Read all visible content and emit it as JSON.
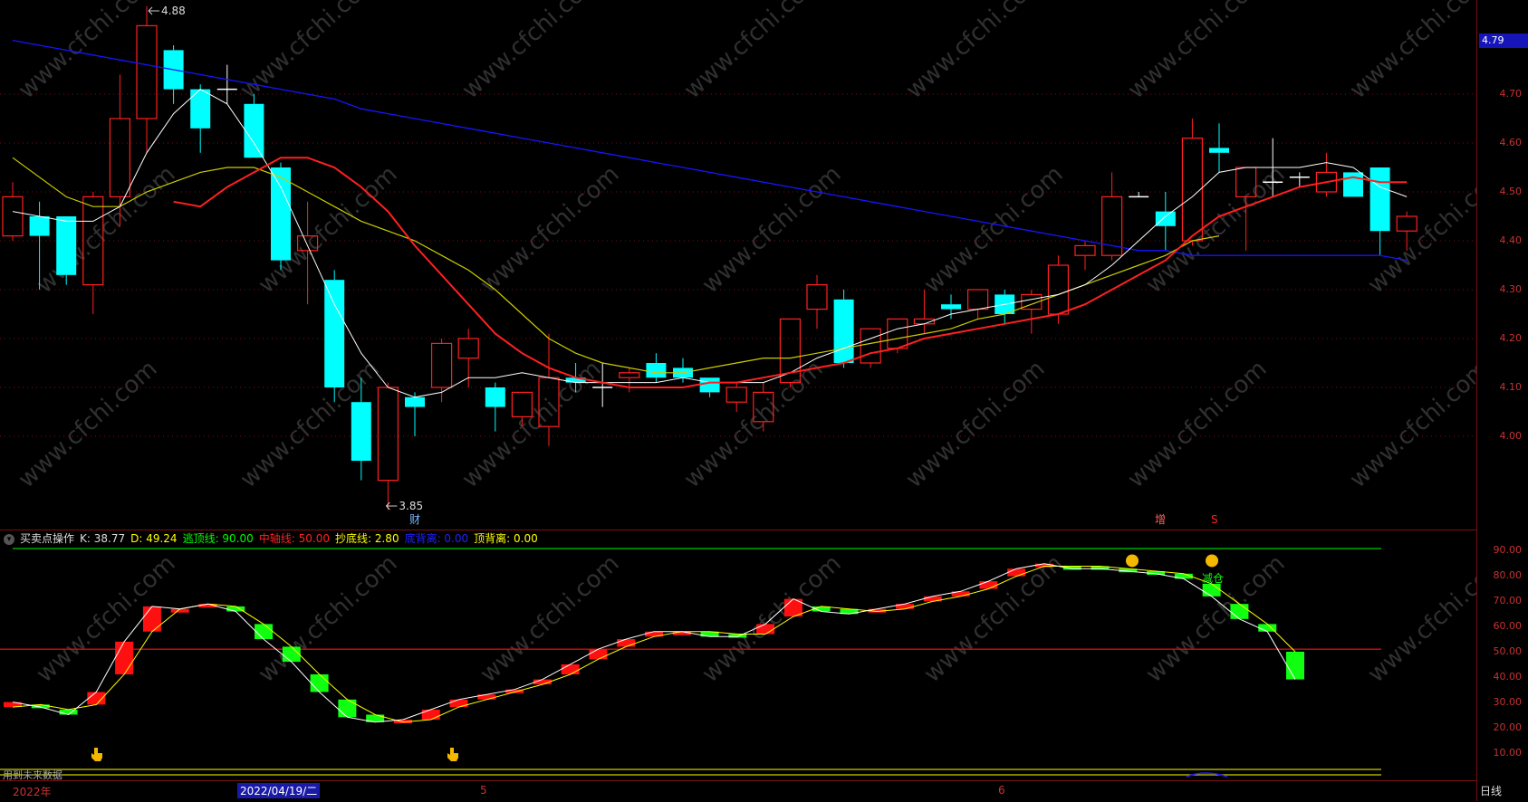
{
  "price_axis": {
    "ticks": [
      "4.70",
      "4.60",
      "4.50",
      "4.40",
      "4.30",
      "4.20",
      "4.10",
      "4.00"
    ],
    "current_price": "4.79"
  },
  "main_chart": {
    "high_label": "4.88",
    "low_label": "3.85",
    "tag_cai": "财",
    "tag_zeng": "增",
    "tag_s": "S",
    "colors": {
      "up": "#ff2020",
      "down": "#00ffff",
      "ma5": "#ffffff",
      "ma10": "#ff2020",
      "ma20": "#cccc00",
      "ma120": "#1515ff"
    }
  },
  "indicator": {
    "name": "买卖点操作",
    "k": "K: 38.77",
    "d": "D: 49.24",
    "top_line": "逃顶线: 90.00",
    "mid_line": "中轴线: 50.00",
    "bottom_line": "抄底线: 2.80",
    "bottom_div": "底背离: 0.00",
    "top_div": "顶背离: 0.00",
    "axis_ticks": [
      "90.00",
      "80.00",
      "70.00",
      "60.00",
      "50.00",
      "40.00",
      "30.00",
      "20.00",
      "10.00"
    ],
    "reduce_label": "减仓",
    "no_data_text": "用到未来数据"
  },
  "date_bar": {
    "year": "2022年",
    "selected_date": "2022/04/19/二",
    "month5": "5",
    "month6": "6",
    "period": "日线"
  },
  "watermark": "www.cfchi.com",
  "chart_data": {
    "type": "candlestick",
    "ohlc": [
      [
        4.41,
        4.52,
        4.4,
        4.49
      ],
      [
        4.45,
        4.48,
        4.3,
        4.41
      ],
      [
        4.45,
        4.45,
        4.31,
        4.33
      ],
      [
        4.31,
        4.5,
        4.25,
        4.49
      ],
      [
        4.49,
        4.74,
        4.43,
        4.65
      ],
      [
        4.65,
        4.88,
        4.58,
        4.84
      ],
      [
        4.79,
        4.8,
        4.68,
        4.71
      ],
      [
        4.71,
        4.72,
        4.58,
        4.63
      ],
      [
        4.71,
        4.76,
        4.68,
        4.71
      ],
      [
        4.68,
        4.7,
        4.57,
        4.57
      ],
      [
        4.55,
        4.56,
        4.34,
        4.36
      ],
      [
        4.38,
        4.48,
        4.27,
        4.41
      ],
      [
        4.32,
        4.34,
        4.07,
        4.1
      ],
      [
        4.07,
        4.12,
        3.91,
        3.95
      ],
      [
        3.91,
        4.11,
        3.85,
        4.1
      ],
      [
        4.08,
        4.09,
        4.0,
        4.06
      ],
      [
        4.1,
        4.2,
        4.07,
        4.19
      ],
      [
        4.16,
        4.22,
        4.1,
        4.2
      ],
      [
        4.1,
        4.11,
        4.01,
        4.06
      ],
      [
        4.04,
        4.09,
        4.02,
        4.09
      ],
      [
        4.02,
        4.21,
        3.98,
        4.12
      ],
      [
        4.12,
        4.15,
        4.09,
        4.11
      ],
      [
        4.1,
        4.15,
        4.06,
        4.1
      ],
      [
        4.12,
        4.14,
        4.09,
        4.13
      ],
      [
        4.15,
        4.17,
        4.11,
        4.12
      ],
      [
        4.14,
        4.16,
        4.11,
        4.12
      ],
      [
        4.12,
        4.12,
        4.08,
        4.09
      ],
      [
        4.07,
        4.11,
        4.05,
        4.1
      ],
      [
        4.03,
        4.11,
        4.01,
        4.09
      ],
      [
        4.11,
        4.24,
        4.1,
        4.24
      ],
      [
        4.26,
        4.33,
        4.22,
        4.31
      ],
      [
        4.28,
        4.3,
        4.14,
        4.15
      ],
      [
        4.15,
        4.22,
        4.14,
        4.22
      ],
      [
        4.18,
        4.24,
        4.17,
        4.24
      ],
      [
        4.23,
        4.3,
        4.21,
        4.24
      ],
      [
        4.27,
        4.29,
        4.24,
        4.26
      ],
      [
        4.26,
        4.3,
        4.24,
        4.3
      ],
      [
        4.29,
        4.3,
        4.23,
        4.25
      ],
      [
        4.26,
        4.3,
        4.21,
        4.29
      ],
      [
        4.25,
        4.37,
        4.23,
        4.35
      ],
      [
        4.37,
        4.4,
        4.34,
        4.39
      ],
      [
        4.37,
        4.54,
        4.36,
        4.49
      ],
      [
        4.49,
        4.5,
        4.49,
        4.49
      ],
      [
        4.46,
        4.5,
        4.38,
        4.43
      ],
      [
        4.4,
        4.65,
        4.39,
        4.61
      ],
      [
        4.59,
        4.64,
        4.54,
        4.58
      ],
      [
        4.49,
        4.55,
        4.38,
        4.55
      ],
      [
        4.52,
        4.61,
        4.49,
        4.52
      ],
      [
        4.53,
        4.54,
        4.51,
        4.53
      ],
      [
        4.5,
        4.58,
        4.49,
        4.54
      ],
      [
        4.54,
        4.54,
        4.49,
        4.49
      ],
      [
        4.55,
        4.55,
        4.37,
        4.42
      ],
      [
        4.42,
        4.46,
        4.38,
        4.45
      ]
    ],
    "ma_series": {
      "ma5": [
        4.46,
        4.45,
        4.44,
        4.44,
        4.47,
        4.58,
        4.66,
        4.71,
        4.68,
        4.6,
        4.51,
        4.39,
        4.27,
        4.17,
        4.1,
        4.08,
        4.09,
        4.12,
        4.12,
        4.13,
        4.12,
        4.11,
        4.11,
        4.11,
        4.11,
        4.12,
        4.11,
        4.11,
        4.11,
        4.13,
        4.16,
        4.18,
        4.2,
        4.22,
        4.23,
        4.25,
        4.26,
        4.27,
        4.28,
        4.29,
        4.31,
        4.35,
        4.4,
        4.45,
        4.49,
        4.54,
        4.55,
        4.55,
        4.55,
        4.56,
        4.55,
        4.51,
        4.49
      ],
      "ma10": [
        null,
        null,
        null,
        null,
        null,
        null,
        4.48,
        4.47,
        4.51,
        4.54,
        4.57,
        4.57,
        4.55,
        4.51,
        4.46,
        4.39,
        4.33,
        4.27,
        4.21,
        4.17,
        4.14,
        4.12,
        4.11,
        4.1,
        4.1,
        4.1,
        4.11,
        4.11,
        4.12,
        4.13,
        4.14,
        4.15,
        4.17,
        4.18,
        4.2,
        4.21,
        4.22,
        4.23,
        4.24,
        4.25,
        4.27,
        4.3,
        4.33,
        4.36,
        4.41,
        4.45,
        4.47,
        4.49,
        4.51,
        4.52,
        4.53,
        4.52,
        4.52
      ],
      "ma20": [
        4.57,
        4.53,
        4.49,
        4.47,
        4.47,
        4.5,
        4.52,
        4.54,
        4.55,
        4.55,
        4.53,
        4.5,
        4.47,
        4.44,
        4.42,
        4.4,
        4.37,
        4.34,
        4.3,
        4.25,
        4.2,
        4.17,
        4.15,
        4.14,
        4.13,
        4.13,
        4.14,
        4.15,
        4.16,
        4.16,
        4.17,
        4.18,
        4.19,
        4.2,
        4.21,
        4.22,
        4.24,
        4.25,
        4.27,
        4.29,
        4.31,
        4.33,
        4.35,
        4.37,
        4.4,
        4.41
      ],
      "ma120": [
        4.81,
        4.8,
        4.79,
        4.78,
        4.77,
        4.76,
        4.75,
        4.74,
        4.73,
        4.72,
        4.71,
        4.7,
        4.69,
        4.67,
        4.66,
        4.65,
        4.64,
        4.63,
        4.62,
        4.61,
        4.6,
        4.59,
        4.58,
        4.57,
        4.56,
        4.55,
        4.54,
        4.53,
        4.52,
        4.51,
        4.5,
        4.49,
        4.48,
        4.47,
        4.46,
        4.45,
        4.44,
        4.43,
        4.42,
        4.41,
        4.4,
        4.39,
        4.38,
        4.38,
        4.37,
        4.37,
        4.37,
        4.37,
        4.37,
        4.37,
        4.37,
        4.37,
        4.36
      ]
    },
    "kd": {
      "k": [
        29,
        27,
        24,
        33,
        53,
        67,
        66,
        68,
        65,
        54,
        45,
        33,
        23,
        21,
        22,
        26,
        30,
        32,
        34,
        38,
        44,
        50,
        54,
        57,
        57,
        55,
        55,
        60,
        70,
        65,
        64,
        66,
        68,
        71,
        73,
        77,
        82,
        84,
        82,
        82,
        81,
        80,
        78,
        71,
        62,
        57,
        38
      ],
      "d": [
        27,
        28,
        26,
        28,
        40,
        57,
        66,
        68,
        67,
        60,
        51,
        40,
        30,
        24,
        21,
        22,
        27,
        30,
        33,
        36,
        40,
        46,
        51,
        55,
        57,
        57,
        56,
        56,
        63,
        67,
        66,
        65,
        66,
        69,
        71,
        74,
        79,
        83,
        83,
        83,
        82,
        81,
        80,
        76,
        68,
        60,
        49
      ]
    },
    "y_range_price": [
      3.85,
      4.88
    ],
    "y_range_indicator": [
      0,
      100
    ]
  }
}
